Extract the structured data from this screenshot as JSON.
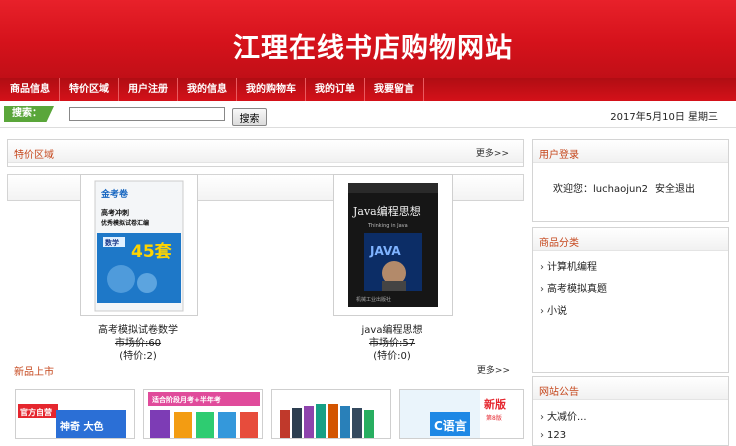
{
  "header": {
    "title": "江理在线书店购物网站"
  },
  "nav": {
    "items": [
      "商品信息",
      "特价区域",
      "用户注册",
      "我的信息",
      "我的购物车",
      "我的订单",
      "我要留言"
    ]
  },
  "search": {
    "label": "搜索：",
    "value": "",
    "button": "搜索"
  },
  "date": "2017年5月10日 星期三",
  "special": {
    "title": "特价区域",
    "more": "更多>>",
    "products": [
      {
        "name": "高考模拟试卷数学",
        "market_price": "市场价:60",
        "special_price": "(特价:2)"
      },
      {
        "name": "java编程思想",
        "market_price": "市场价:57",
        "special_price": "(特价:0)"
      }
    ]
  },
  "new_arrivals": {
    "title": "新品上市",
    "more": "更多>>"
  },
  "login": {
    "title": "用户登录",
    "welcome": "欢迎您：luchaojun2",
    "logout": "安全退出"
  },
  "categories": {
    "title": "商品分类",
    "items": [
      "计算机编程",
      "高考模拟真题",
      "小说"
    ]
  },
  "notice": {
    "title": "网站公告",
    "items": [
      "大减价...",
      "123"
    ]
  },
  "book_covers": {
    "math_brand": "金考卷",
    "math_line1": "高考冲刺",
    "math_line2": "优秀模拟试卷汇编",
    "math_subject": "数学",
    "math_big": "45套",
    "java_title": "Java编程思想",
    "java_sub": "Thinking in Java",
    "java_logo": "JAVA",
    "java_pub": "机械工业出版社",
    "new1_badge": "官方自营",
    "new1_text": "神奇 大色",
    "new2_text": "适合阶段月考+半年考",
    "new3_text": "",
    "new4_word": "新版",
    "new4_big": "C语言",
    "new4_small": "第8版"
  },
  "colors": {
    "brand_red": "#d5121b",
    "search_green": "#5aa63a",
    "section_title": "#c5461b"
  }
}
